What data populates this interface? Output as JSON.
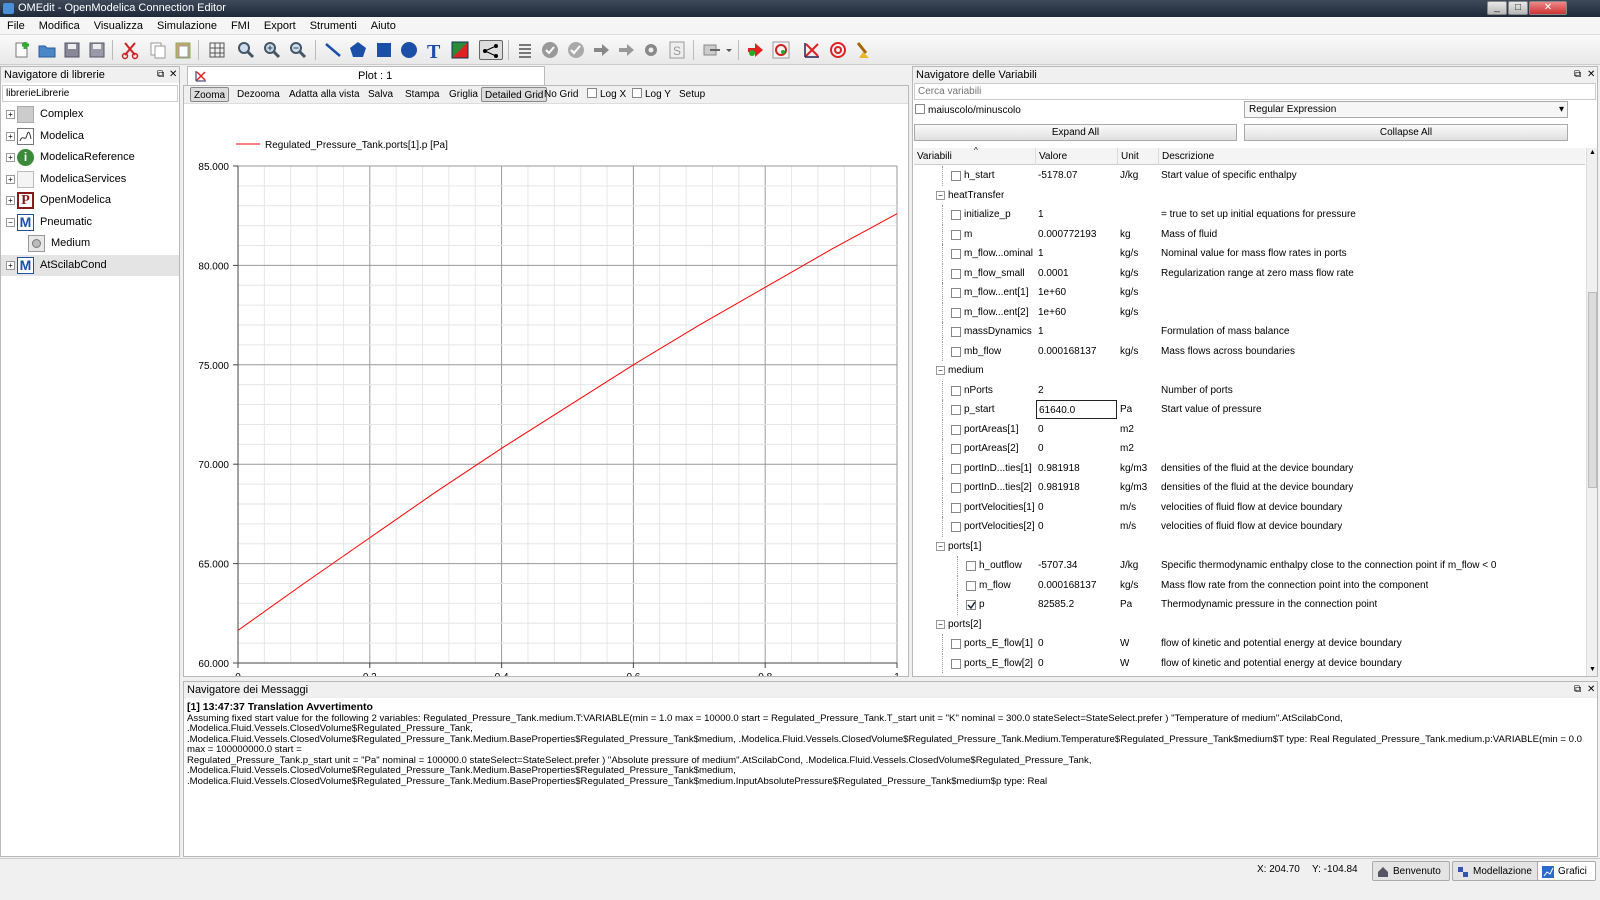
{
  "window": {
    "title": "OMEdit - OpenModelica Connection Editor"
  },
  "menu": [
    "File",
    "Modifica",
    "Visualizza",
    "Simulazione",
    "FMI",
    "Export",
    "Strumenti",
    "Aiuto"
  ],
  "libraries": {
    "title": "Navigatore di librerie",
    "filter": "librerieLibrerie",
    "items": [
      {
        "label": "Complex",
        "icon": "grey-box-icon",
        "expandable": true
      },
      {
        "label": "Modelica",
        "icon": "modelica-icon",
        "expandable": true
      },
      {
        "label": "ModelicaReference",
        "icon": "info-icon",
        "expandable": true
      },
      {
        "label": "ModelicaServices",
        "icon": "blank-box-icon",
        "expandable": true
      },
      {
        "label": "OpenModelica",
        "icon": "p-letter-icon",
        "expandable": true
      },
      {
        "label": "Pneumatic",
        "icon": "m-letter-icon",
        "expandable": true,
        "expanded": true
      },
      {
        "label": "Medium",
        "icon": "medium-icon",
        "child": true
      },
      {
        "label": "AtScilabCond",
        "icon": "m-letter-icon",
        "expandable": true,
        "selected": true
      }
    ]
  },
  "plot": {
    "tab_label": "Plot : 1",
    "toolbar": [
      {
        "label": "Zooma",
        "active": true
      },
      {
        "label": "Dezooma"
      },
      {
        "label": "Adatta alla vista"
      },
      {
        "label": "Salva"
      },
      {
        "label": "Stampa"
      },
      {
        "label": "Griglia"
      },
      {
        "label": "Detailed Grid",
        "active": true
      },
      {
        "label": "No Grid"
      },
      {
        "label": "Log X",
        "checkbox": true
      },
      {
        "label": "Log Y",
        "checkbox": true
      },
      {
        "label": "Setup"
      }
    ]
  },
  "chart_data": {
    "type": "line",
    "series": [
      {
        "name": "Regulated_Pressure_Tank.ports[1].p [Pa]",
        "color": "#ff0000",
        "x": [
          0,
          0.1,
          0.2,
          0.3,
          0.4,
          0.5,
          0.6,
          0.7,
          0.8,
          0.9,
          1
        ],
        "y": [
          61.64,
          64.0,
          66.3,
          68.6,
          70.8,
          72.9,
          75.0,
          77.0,
          78.9,
          80.8,
          82.6
        ]
      }
    ],
    "xlim": [
      0,
      1
    ],
    "ylim": [
      60,
      85
    ],
    "x_ticks": [
      "0",
      "0,2",
      "0,4",
      "0,6",
      "0,8",
      "1"
    ],
    "y_ticks": [
      "60.000",
      "65.000",
      "70.000",
      "75.000",
      "80.000",
      "85.000"
    ],
    "grid": "detailed",
    "legend": "top-left"
  },
  "variables": {
    "title": "Navigatore delle Variabili",
    "search_placeholder": "Cerca variabili",
    "case_label": "maiuscolo/minuscolo",
    "filter_mode": "Regular Expression",
    "expand_all": "Expand All",
    "collapse_all": "Collapse All",
    "columns": [
      "Variabili",
      "Valore",
      "Unit",
      "Descrizione"
    ],
    "rows": [
      {
        "name": "h_start",
        "value": "-5178.07",
        "unit": "J/kg",
        "desc": "Start value of specific enthalpy",
        "level": 1,
        "chk": true
      },
      {
        "name": "heatTransfer",
        "value": "",
        "unit": "",
        "desc": "",
        "level": 0,
        "group": true
      },
      {
        "name": "initialize_p",
        "value": "1",
        "unit": "",
        "desc": "= true to set up initial equations for pressure",
        "level": 1,
        "chk": true
      },
      {
        "name": "m",
        "value": "0.000772193",
        "unit": "kg",
        "desc": "Mass of fluid",
        "level": 1,
        "chk": true
      },
      {
        "name": "m_flow...ominal",
        "value": "1",
        "unit": "kg/s",
        "desc": "Nominal value for mass flow rates in ports",
        "level": 1,
        "chk": true
      },
      {
        "name": "m_flow_small",
        "value": "0.0001",
        "unit": "kg/s",
        "desc": "Regularization range at zero mass flow rate",
        "level": 1,
        "chk": true
      },
      {
        "name": "m_flow...ent[1]",
        "value": "1e+60",
        "unit": "kg/s",
        "desc": "",
        "level": 1,
        "chk": true
      },
      {
        "name": "m_flow...ent[2]",
        "value": "1e+60",
        "unit": "kg/s",
        "desc": "",
        "level": 1,
        "chk": true
      },
      {
        "name": "massDynamics",
        "value": "1",
        "unit": "",
        "desc": "Formulation of mass balance",
        "level": 1,
        "chk": true
      },
      {
        "name": "mb_flow",
        "value": "0.000168137",
        "unit": "kg/s",
        "desc": "Mass flows across boundaries",
        "level": 1,
        "chk": true
      },
      {
        "name": "medium",
        "value": "",
        "unit": "",
        "desc": "",
        "level": 0,
        "group": true
      },
      {
        "name": "nPorts",
        "value": "2",
        "unit": "",
        "desc": "Number of ports",
        "level": 1,
        "chk": true
      },
      {
        "name": "p_start",
        "value": "61640.0",
        "unit": "Pa",
        "desc": "Start value of pressure",
        "level": 1,
        "chk": true,
        "editing": true
      },
      {
        "name": "portAreas[1]",
        "value": "0",
        "unit": "m2",
        "desc": "",
        "level": 1,
        "chk": true
      },
      {
        "name": "portAreas[2]",
        "value": "0",
        "unit": "m2",
        "desc": "",
        "level": 1,
        "chk": true
      },
      {
        "name": "portInD...ties[1]",
        "value": "0.981918",
        "unit": "kg/m3",
        "desc": "densities of the fluid at the device boundary",
        "level": 1,
        "chk": true
      },
      {
        "name": "portInD...ties[2]",
        "value": "0.981918",
        "unit": "kg/m3",
        "desc": "densities of the fluid at the device boundary",
        "level": 1,
        "chk": true
      },
      {
        "name": "portVelocities[1]",
        "value": "0",
        "unit": "m/s",
        "desc": "velocities of fluid flow at device boundary",
        "level": 1,
        "chk": true
      },
      {
        "name": "portVelocities[2]",
        "value": "0",
        "unit": "m/s",
        "desc": "velocities of fluid flow at device boundary",
        "level": 1,
        "chk": true
      },
      {
        "name": "ports[1]",
        "value": "",
        "unit": "",
        "desc": "",
        "level": 0,
        "group": true
      },
      {
        "name": "h_outflow",
        "value": "-5707.34",
        "unit": "J/kg",
        "desc": "Specific thermodynamic enthalpy close to the connection point if m_flow < 0",
        "level": 2,
        "chk": true
      },
      {
        "name": "m_flow",
        "value": "0.000168137",
        "unit": "kg/s",
        "desc": "Mass flow rate from the connection point into the component",
        "level": 2,
        "chk": true
      },
      {
        "name": "p",
        "value": "82585.2",
        "unit": "Pa",
        "desc": "Thermodynamic pressure in the connection point",
        "level": 2,
        "chk": true,
        "checked": true
      },
      {
        "name": "ports[2]",
        "value": "",
        "unit": "",
        "desc": "",
        "level": 0,
        "group": true
      },
      {
        "name": "ports_E_flow[1]",
        "value": "0",
        "unit": "W",
        "desc": "flow of kinetic and potential energy at device boundary",
        "level": 1,
        "chk": true
      },
      {
        "name": "ports_E_flow[2]",
        "value": "0",
        "unit": "W",
        "desc": "flow of kinetic and potential energy at device boundary",
        "level": 1,
        "chk": true
      }
    ]
  },
  "messages": {
    "title": "Navigatore dei Messaggi",
    "header": "[1] 13:47:37 Translation Avvertimento",
    "lines": [
      "Assuming fixed start value for the following 2 variables: Regulated_Pressure_Tank.medium.T:VARIABLE(min = 1.0 max = 10000.0 start = Regulated_Pressure_Tank.T_start unit = \"K\" nominal = 300.0 stateSelect=StateSelect.prefer ) \"Temperature of medium\".AtScilabCond, .Modelica.Fluid.Vessels.ClosedVolume$Regulated_Pressure_Tank,",
      ".Modelica.Fluid.Vessels.ClosedVolume$Regulated_Pressure_Tank.Medium.BaseProperties$Regulated_Pressure_Tank$medium, .Modelica.Fluid.Vessels.ClosedVolume$Regulated_Pressure_Tank.Medium.Temperature$Regulated_Pressure_Tank$medium$T type: Real Regulated_Pressure_Tank.medium.p:VARIABLE(min = 0.0 max = 100000000.0 start =",
      "Regulated_Pressure_Tank.p_start unit = \"Pa\" nominal = 100000.0 stateSelect=StateSelect.prefer ) \"Absolute pressure of medium\".AtScilabCond, .Modelica.Fluid.Vessels.ClosedVolume$Regulated_Pressure_Tank, .Modelica.Fluid.Vessels.ClosedVolume$Regulated_Pressure_Tank.Medium.BaseProperties$Regulated_Pressure_Tank$medium,",
      ".Modelica.Fluid.Vessels.ClosedVolume$Regulated_Pressure_Tank.Medium.BaseProperties$Regulated_Pressure_Tank$medium.InputAbsolutePressure$Regulated_Pressure_Tank$medium$p type: Real"
    ]
  },
  "status": {
    "x": "X: 204.70",
    "y": "Y: -104.84",
    "tabs": [
      "Benvenuto",
      "Modellazione",
      "Grafici"
    ]
  }
}
